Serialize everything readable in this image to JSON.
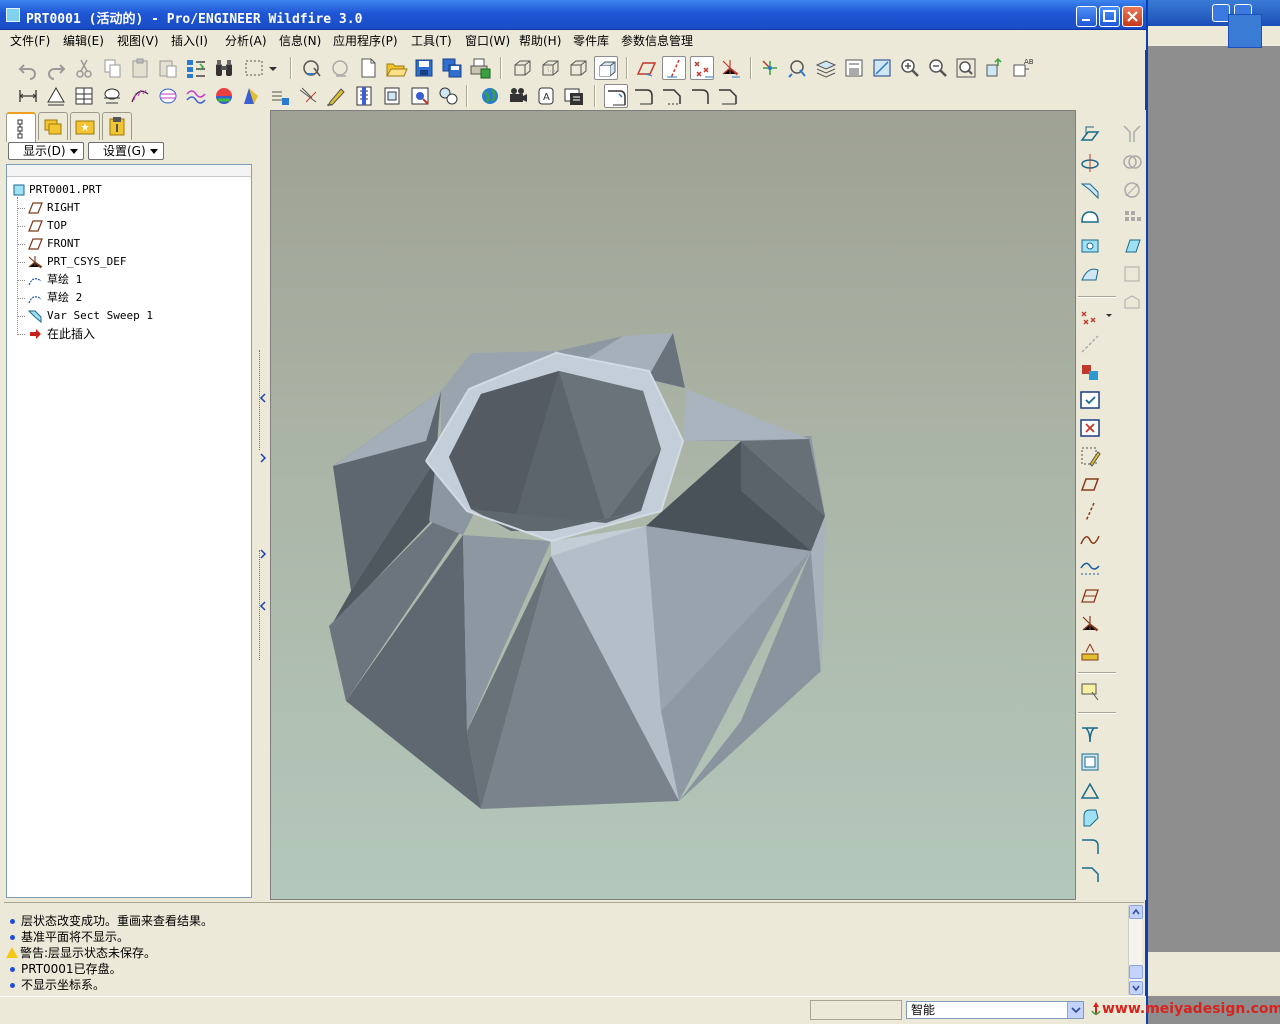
{
  "window": {
    "title": "PRT0001 (活动的) - Pro/ENGINEER Wildfire 3.0"
  },
  "menu": [
    "文件(F)",
    "编辑(E)",
    "视图(V)",
    "插入(I)",
    "分析(A)",
    "信息(N)",
    "应用程序(P)",
    "工具(T)",
    "窗口(W)",
    "帮助(H)",
    "零件库",
    "参数信息管理"
  ],
  "panel": {
    "show_button": "显示(D)",
    "settings_button": "设置(G)"
  },
  "tree": {
    "root": "PRT0001.PRT",
    "items": [
      "RIGHT",
      "TOP",
      "FRONT",
      "PRT_CSYS_DEF",
      "草绘 1",
      "草绘 2",
      "Var Sect Sweep 1",
      "在此插入"
    ]
  },
  "messages": [
    "层状态改变成功。重画来查看结果。",
    "基准平面将不显示。",
    "警告:层显示状态未保存。",
    "PRT0001已存盘。",
    "不显示坐标系。"
  ],
  "status": {
    "filter_value": "智能",
    "watermark": "www.meiyadesign.com"
  },
  "colors": {
    "titlebar": "#1f56d6",
    "viewport_top": "#9ea194",
    "viewport_bottom": "#b3c8bb",
    "model_gray": "#8e98a2",
    "watermark": "#d8231c"
  }
}
